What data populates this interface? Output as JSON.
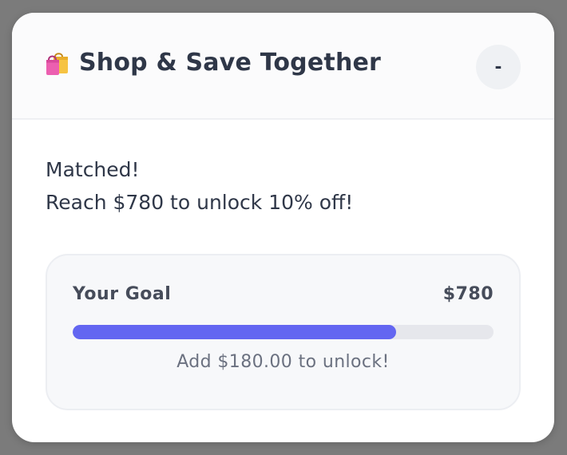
{
  "header": {
    "icon": "shopping-bags-icon",
    "title": "Shop & Save Together",
    "minimize_label": "-"
  },
  "message": {
    "line1": "Matched!",
    "line2": "Reach $780 to unlock 10% off!"
  },
  "goal": {
    "label": "Your Goal",
    "amount": "$780",
    "progress_fraction": 0.769,
    "remaining_text": "Add $180.00 to unlock!"
  },
  "colors": {
    "accent": "#6366f1",
    "text": "#2f3748",
    "track": "#e6e7ec"
  }
}
